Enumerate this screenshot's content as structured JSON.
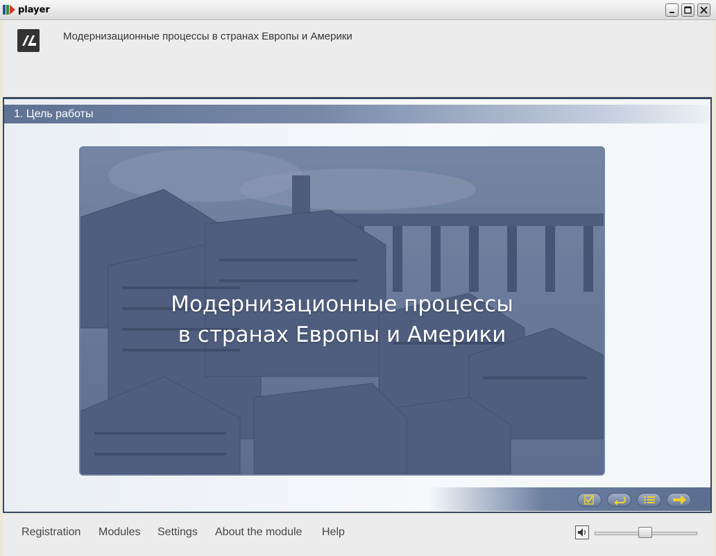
{
  "window": {
    "title": "player"
  },
  "header": {
    "course_title": "Модернизационные процессы в странах Европы и Америки"
  },
  "section": {
    "title": "1. Цель работы"
  },
  "hero": {
    "line1": "Модернизационные процессы",
    "line2": "в странах Европы и Америки"
  },
  "nav_buttons": [
    {
      "name": "check-icon"
    },
    {
      "name": "back-arrow-icon"
    },
    {
      "name": "list-icon"
    },
    {
      "name": "next-arrow-icon"
    }
  ],
  "menu": {
    "registration": "Registration",
    "modules": "Modules",
    "settings": "Settings",
    "about": "About the module",
    "help": "Help"
  },
  "volume": {
    "level": 0.5
  },
  "colors": {
    "accent": "#354863",
    "nav_arrow": "#f2d12a"
  }
}
